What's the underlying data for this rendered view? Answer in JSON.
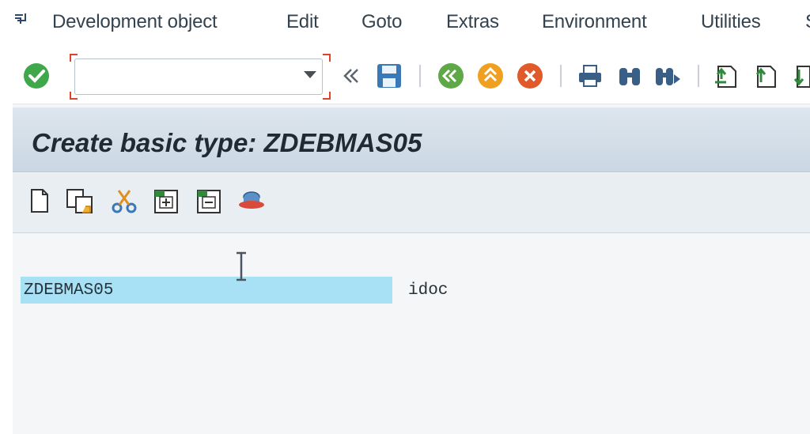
{
  "menubar": {
    "items": [
      "Development object",
      "Edit",
      "Goto",
      "Extras",
      "Environment",
      "Utilities"
    ],
    "trailing": "S"
  },
  "toolbar": {
    "command_field_value": "",
    "icons": [
      "enter-check",
      "command-field",
      "collapse-arrows",
      "save",
      "back",
      "exit",
      "cancel",
      "print",
      "find",
      "find-next",
      "first-page",
      "previous-page",
      "next-page"
    ]
  },
  "title": {
    "text": "Create basic type: ZDEBMAS05"
  },
  "app_toolbar": {
    "icons": [
      "create",
      "copy",
      "cut",
      "insert",
      "delete",
      "display-attributes"
    ]
  },
  "content": {
    "node_name": "ZDEBMAS05",
    "node_description": "idoc"
  },
  "colors": {
    "selection": "#a8e1f5",
    "title_band": "#cad7e3",
    "ok_green": "#3fa84a",
    "back_green": "#6ab04c",
    "exit_orange": "#f0a020",
    "cancel_red": "#e05a2a"
  }
}
